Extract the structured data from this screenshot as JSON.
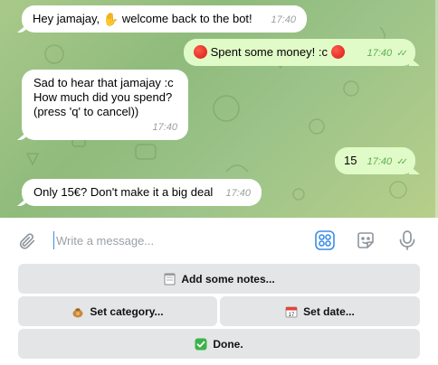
{
  "messages": [
    {
      "direction": "in",
      "text_before": "Hey jamajay, ",
      "icon": "waving-hand",
      "text_after": " welcome back to the bot!",
      "time": "17:40"
    },
    {
      "direction": "out",
      "icon_left": "red-circle",
      "text": " Spent some money! :c ",
      "icon_right": "red-circle",
      "time": "17:40",
      "read": "✓✓"
    },
    {
      "direction": "in",
      "text": "Sad to hear that jamajay :c\nHow much did you spend?\n(press 'q' to cancel))",
      "time": "17:40"
    },
    {
      "direction": "out",
      "text": "15",
      "time": "17:40",
      "read": "✓✓"
    },
    {
      "direction": "in",
      "text": "Only 15€? Don't make it a big deal",
      "time": "17:40"
    }
  ],
  "composer": {
    "placeholder": "Write a message...",
    "value": ""
  },
  "keyboard": {
    "notes": {
      "icon": "notepad",
      "label": "Add some notes..."
    },
    "category": {
      "icon": "money-bag",
      "label": "Set category..."
    },
    "date": {
      "icon": "calendar",
      "label": "Set date..."
    },
    "done": {
      "icon": "check-mark-button",
      "label": "Done."
    }
  },
  "colors": {
    "incoming_bubble": "#ffffff",
    "outgoing_bubble": "#e0fbc7",
    "outgoing_time": "#5dae56",
    "keyboard_button": "#e4e5e7",
    "accent": "#3a8ee6"
  }
}
